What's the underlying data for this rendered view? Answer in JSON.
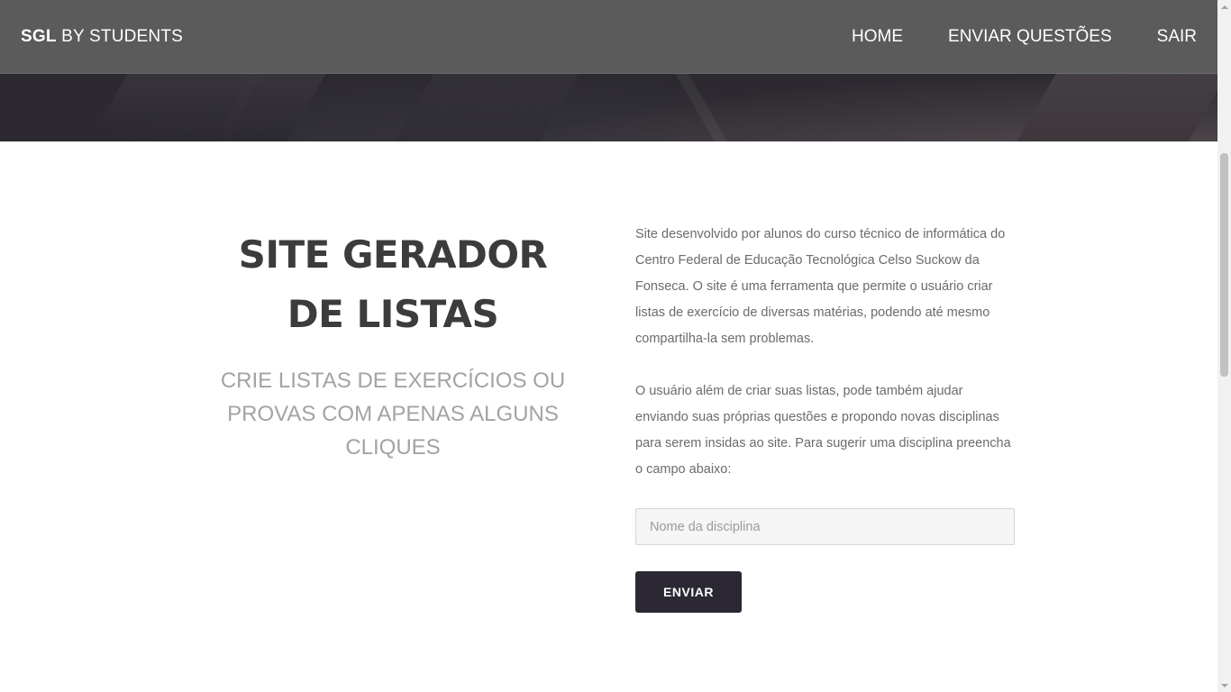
{
  "navbar": {
    "brand_bold": "SGL",
    "brand_rest": "BY STUDENTS",
    "links": [
      "HOME",
      "ENVIAR QUESTÕES",
      "SAIR"
    ]
  },
  "main": {
    "title": "SITE GERADOR DE LISTAS",
    "subtitle": "CRIE LISTAS DE EXERCÍCIOS OU PROVAS COM APENAS ALGUNS CLIQUES",
    "paragraph_1": "Site desenvolvido por alunos do curso técnico de informática do Centro Federal de Educação Tecnológica Celso Suckow da Fonseca. O site é uma ferramenta que permite o usuário criar listas de exercício de diversas matérias, podendo até mesmo compartilha-la sem problemas.",
    "paragraph_2": "O usuário além de criar suas listas, pode também ajudar enviando suas próprias questões e propondo novas disciplinas para serem insidas ao site. Para sugerir uma disciplina preencha o campo abaixo:",
    "input_placeholder": "Nome da disciplina",
    "submit_label": "ENVIAR"
  },
  "colors": {
    "navbar_bg": "#5b5b5b",
    "hero_bg": "#2c2a30",
    "button_bg": "#2b2833",
    "title_color": "#3c3c3c",
    "subtitle_color": "#a3a3a3"
  }
}
